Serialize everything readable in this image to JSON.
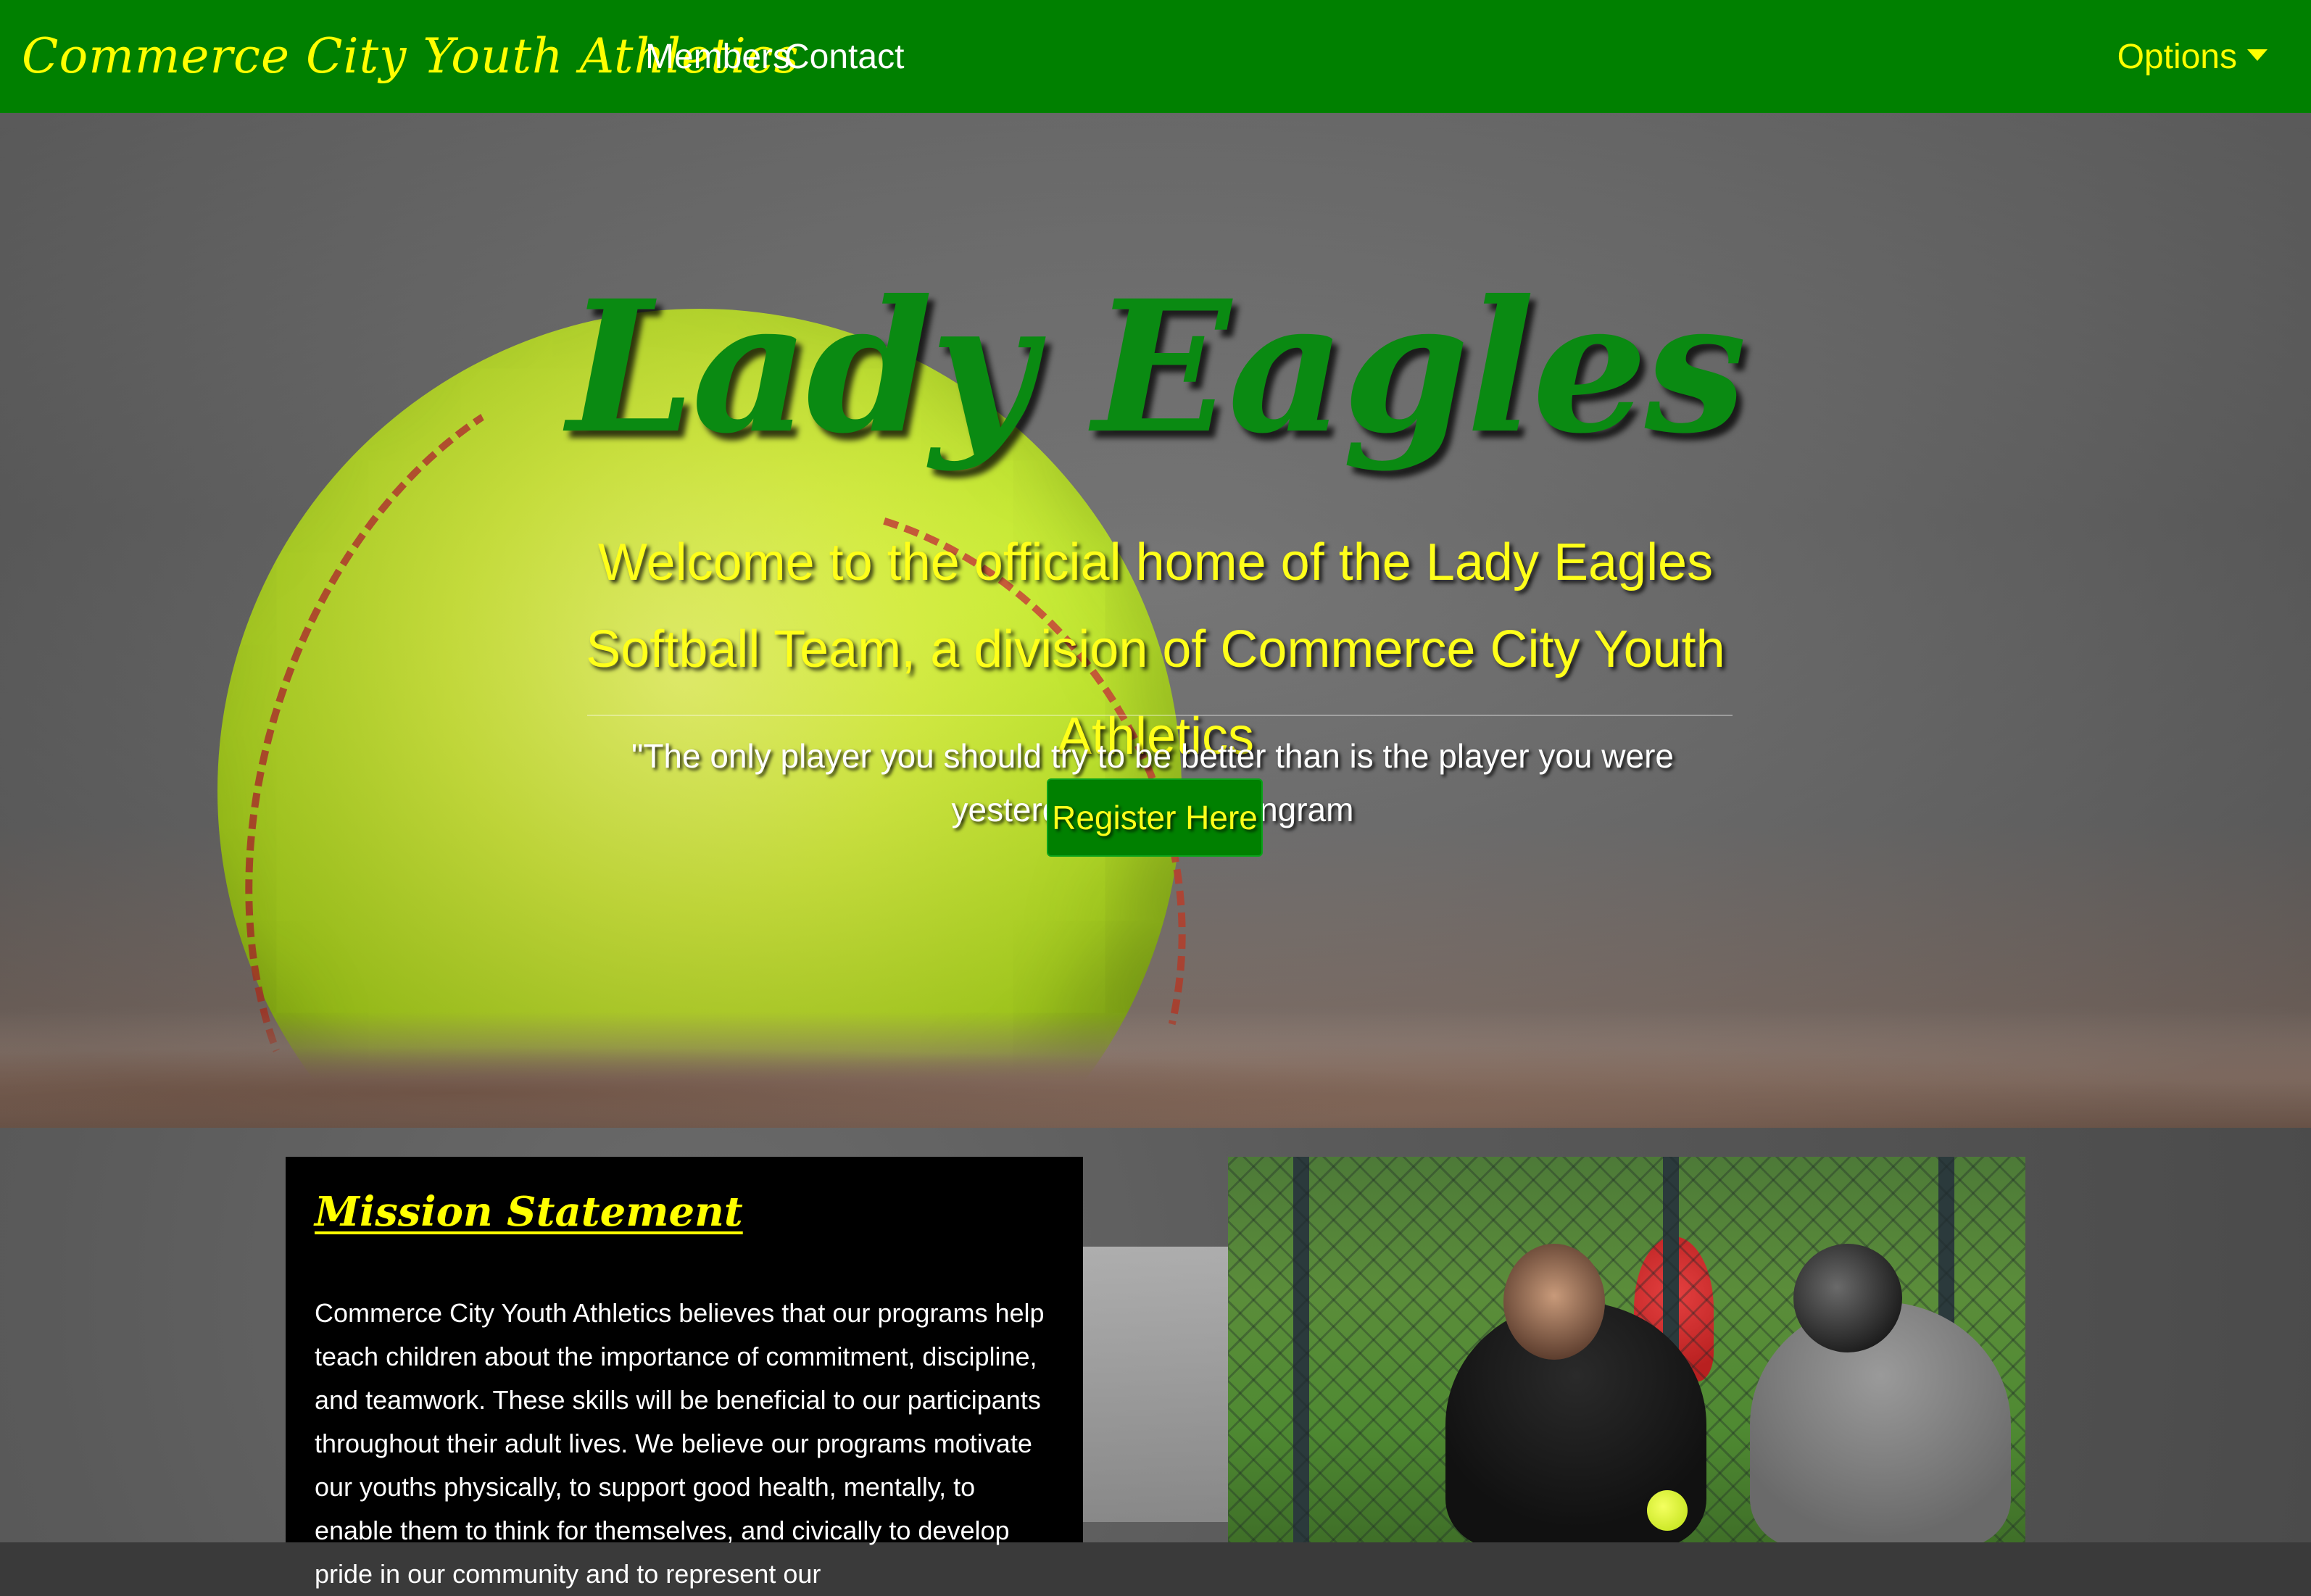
{
  "navbar": {
    "brand": "Commerce City Youth Athletics",
    "links": [
      "Members",
      "Contact"
    ],
    "options_label": "Options"
  },
  "hero": {
    "title": "Lady Eagles",
    "lead": "Welcome to the official home of the Lady Eagles Softball Team, a division of Commerce City Youth Athletics",
    "quote": "\"The only player you should try to be better than is the player you were yesterday.\" - Coach Ingram",
    "register_label": "Register Here"
  },
  "mission": {
    "title": "Mission Statement",
    "body": "Commerce City Youth Athletics believes that our programs help teach children about the importance of commitment, discipline, and teamwork. These skills will be beneficial to our participants throughout their adult lives. We believe our programs motivate our youths physically, to support good health, mentally, to enable them to think for themselves, and civically to develop pride in our community and to represent our"
  },
  "colors": {
    "brand_green": "#008000",
    "accent_yellow": "#ffff00",
    "title_green": "#0a8a12",
    "mission_bg": "#000000"
  },
  "icons": {
    "options_caret": "caret-down-icon"
  }
}
